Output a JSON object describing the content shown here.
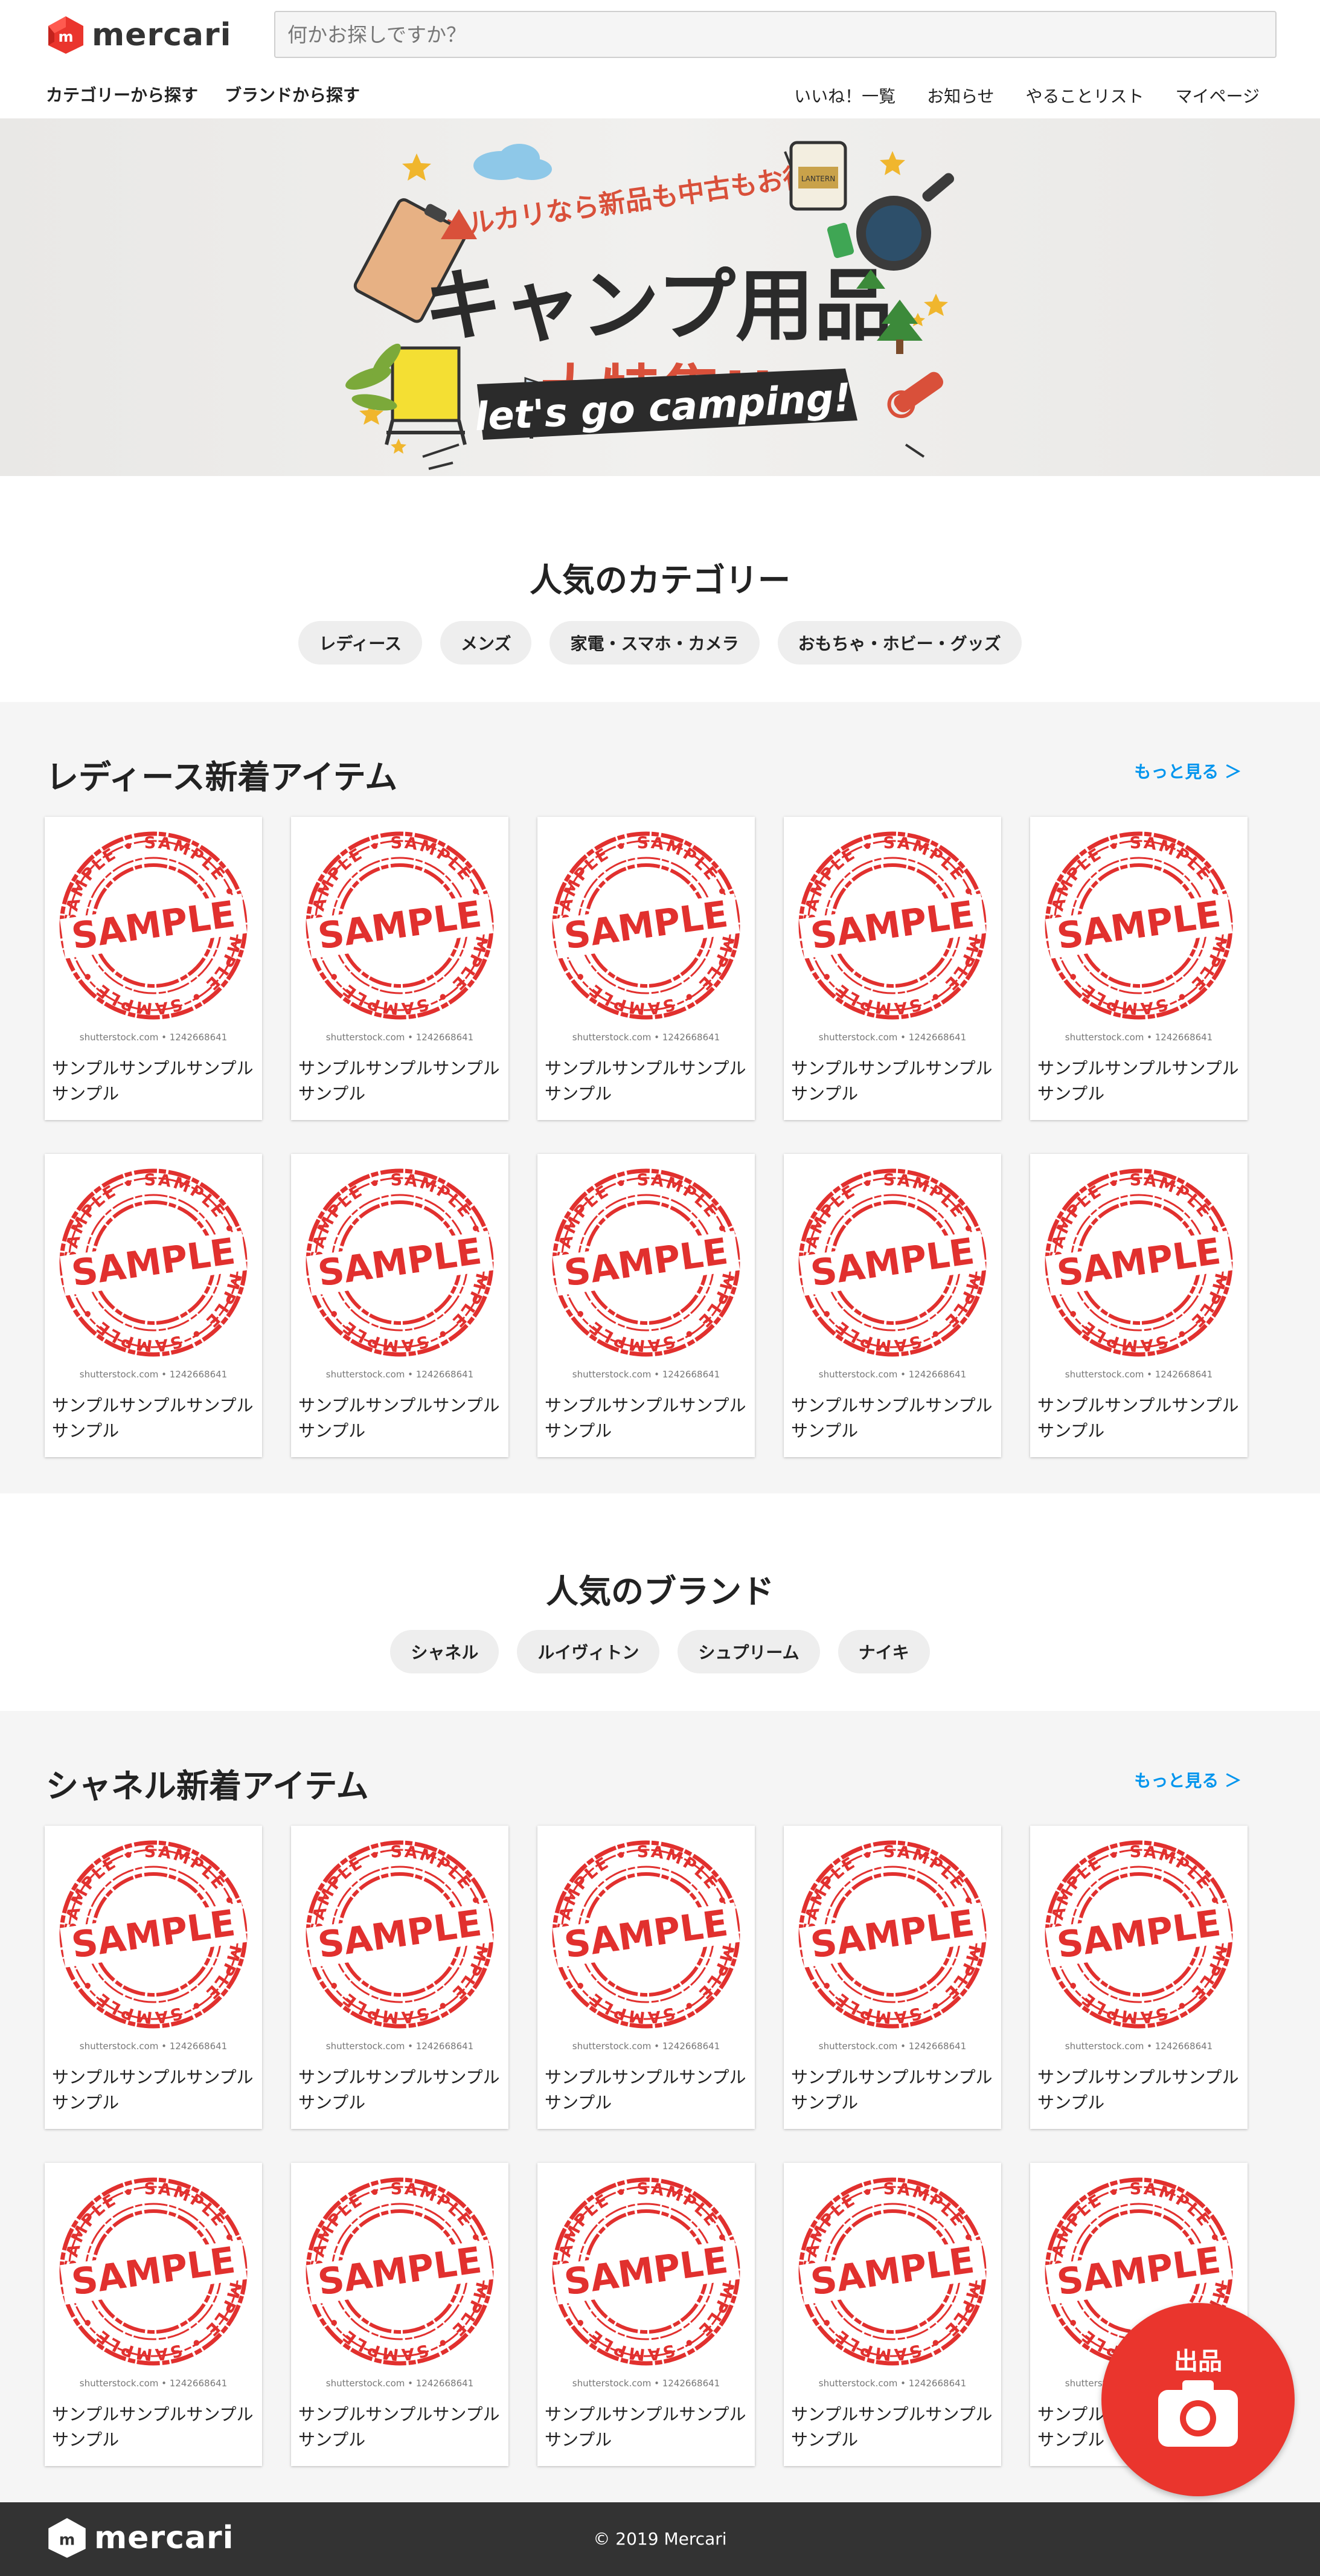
{
  "brand": {
    "name": "mercari"
  },
  "search": {
    "placeholder": "何かお探しですか？"
  },
  "nav_left": [
    "カテゴリーから探す",
    "ブランドから探す"
  ],
  "nav_right": [
    "いいね！一覧",
    "お知らせ",
    "やることリスト",
    "マイページ"
  ],
  "banner": {
    "tagline": "メルカリなら新品も中古もお得！",
    "title_line1": "キャンプ用品",
    "title_line2": "大特集!!",
    "ribbon": "let's go camping!",
    "lantern_label": "LANTERN"
  },
  "popular_categories": {
    "title": "人気のカテゴリー",
    "chips": [
      "レディース",
      "メンズ",
      "家電・スマホ・カメラ",
      "おもちゃ・ホビー・グッズ"
    ]
  },
  "ladies_section": {
    "title": "レディース新着アイテム",
    "more": "もっと見る ＞",
    "items": [
      "サンプルサンプルサンプルサンプル",
      "サンプルサンプルサンプルサンプル",
      "サンプルサンプルサンプルサンプル",
      "サンプルサンプルサンプルサンプル",
      "サンプルサンプルサンプルサンプル",
      "サンプルサンプルサンプルサンプル",
      "サンプルサンプルサンプルサンプル",
      "サンプルサンプルサンプルサンプル",
      "サンプルサンプルサンプルサンプル",
      "サンプルサンプルサンプルサンプル"
    ]
  },
  "popular_brands": {
    "title": "人気のブランド",
    "chips": [
      "シャネル",
      "ルイヴィトン",
      "シュプリーム",
      "ナイキ"
    ]
  },
  "chanel_section": {
    "title": "シャネル新着アイテム",
    "more": "もっと見る ＞",
    "items": [
      "サンプルサンプルサンプルサンプル",
      "サンプルサンプルサンプルサンプル",
      "サンプルサンプルサンプルサンプル",
      "サンプルサンプルサンプルサンプル",
      "サンプルサンプルサンプルサンプル",
      "サンプルサンプルサンプルサンプル",
      "サンプルサンプルサンプルサンプル",
      "サンプルサンプルサンプルサンプル",
      "サンプルサンプルサンプルサンプル",
      "サンプルサンプルサンプルサンプル"
    ]
  },
  "sample_stamp": {
    "center_word": "SAMPLE",
    "ring_word": "SAMPLE",
    "credit": "shutterstock.com • 1242668641",
    "color": "#e1302e"
  },
  "sell_button": {
    "label": "出品",
    "icon": "camera-icon"
  },
  "footer": {
    "copyright": "© 2019 Mercari"
  },
  "colors": {
    "accent": "#ea352d",
    "link": "#0095ee",
    "footer": "#333333"
  }
}
